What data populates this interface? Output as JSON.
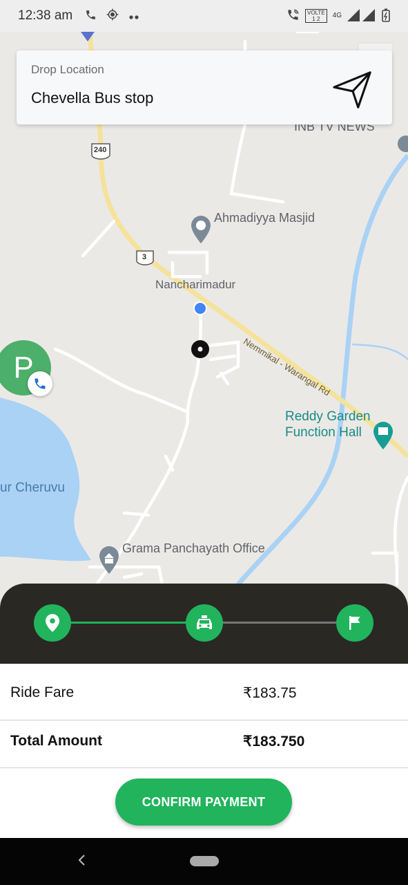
{
  "status_bar": {
    "time": "12:38 am",
    "icons": [
      "phone-icon",
      "location-icon",
      "more-dots-icon",
      "wifi-call-icon",
      "volte-icon",
      "signal-icon",
      "battery-icon"
    ],
    "volte_line1": "VOLTE",
    "volte_line2": "1 2",
    "network": "4G"
  },
  "drop_location": {
    "label": "Drop Location",
    "value": "Chevella Bus stop"
  },
  "map": {
    "labels": {
      "inb_tv": "INB TV NEWS",
      "masjid": "Ahmadiyya Masjid",
      "nancharimadur": "Nancharimadur",
      "road": "Nemmikal - Warangal Rd",
      "reddy_line1": "Reddy Garden",
      "reddy_line2": "Function Hall",
      "cheruvu": "ur Cheruvu",
      "panchayath": "Grama Panchayath Office",
      "shield_240": "240",
      "shield_3": "3"
    }
  },
  "driver": {
    "initial": "P"
  },
  "progress": {
    "steps": [
      "pickup-pin-icon",
      "taxi-icon",
      "flag-icon"
    ],
    "colors": {
      "done": "#21b45d",
      "pending": "#777777"
    }
  },
  "fare": {
    "ride_fare_label": "Ride Fare",
    "ride_fare_value": "₹183.75",
    "total_label": "Total Amount",
    "total_value": "₹183.750",
    "confirm_label": "CONFIRM PAYMENT"
  },
  "colors": {
    "accent": "#21b45d",
    "panel": "#2a2823",
    "water": "#a9d2f5",
    "avatar": "#4caf6a"
  }
}
